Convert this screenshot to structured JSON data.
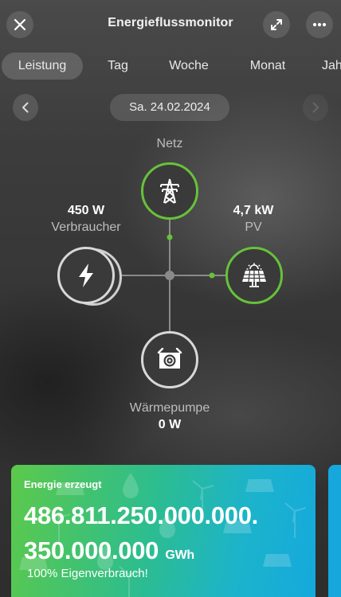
{
  "header": {
    "title": "Energieflussmonitor",
    "close_icon": "close-icon",
    "expand_icon": "expand-icon",
    "more_icon": "more-icon"
  },
  "tabs": [
    {
      "label": "Leistung",
      "active": true
    },
    {
      "label": "Tag",
      "active": false
    },
    {
      "label": "Woche",
      "active": false
    },
    {
      "label": "Monat",
      "active": false
    },
    {
      "label": "Jahr",
      "active": false
    }
  ],
  "date": {
    "label": "Sa. 24.02.2024",
    "prev_icon": "chevron-left-icon",
    "next_icon": "chevron-right-icon",
    "next_enabled": false
  },
  "flow": {
    "grid": {
      "name": "Netz",
      "icon": "power-tower-icon"
    },
    "consumer": {
      "value": "450  W",
      "name": "Verbraucher",
      "icon": "lightning-icon"
    },
    "pv": {
      "value": "4,7  kW",
      "name": "PV",
      "icon": "solar-panel-icon"
    },
    "heatpump": {
      "value": "0  W",
      "name": "Wärmepumpe",
      "icon": "heat-pump-icon"
    }
  },
  "card": {
    "label": "Energie erzeugt",
    "value_line1": "486.811.250.000.000.",
    "value_line2": "350.000.000",
    "unit": "GWh",
    "subtitle": "100% Eigenverbrauch!"
  },
  "colors": {
    "accent_green": "#67c23a",
    "card_start": "#5cc94a",
    "card_end": "#15a9dc"
  }
}
